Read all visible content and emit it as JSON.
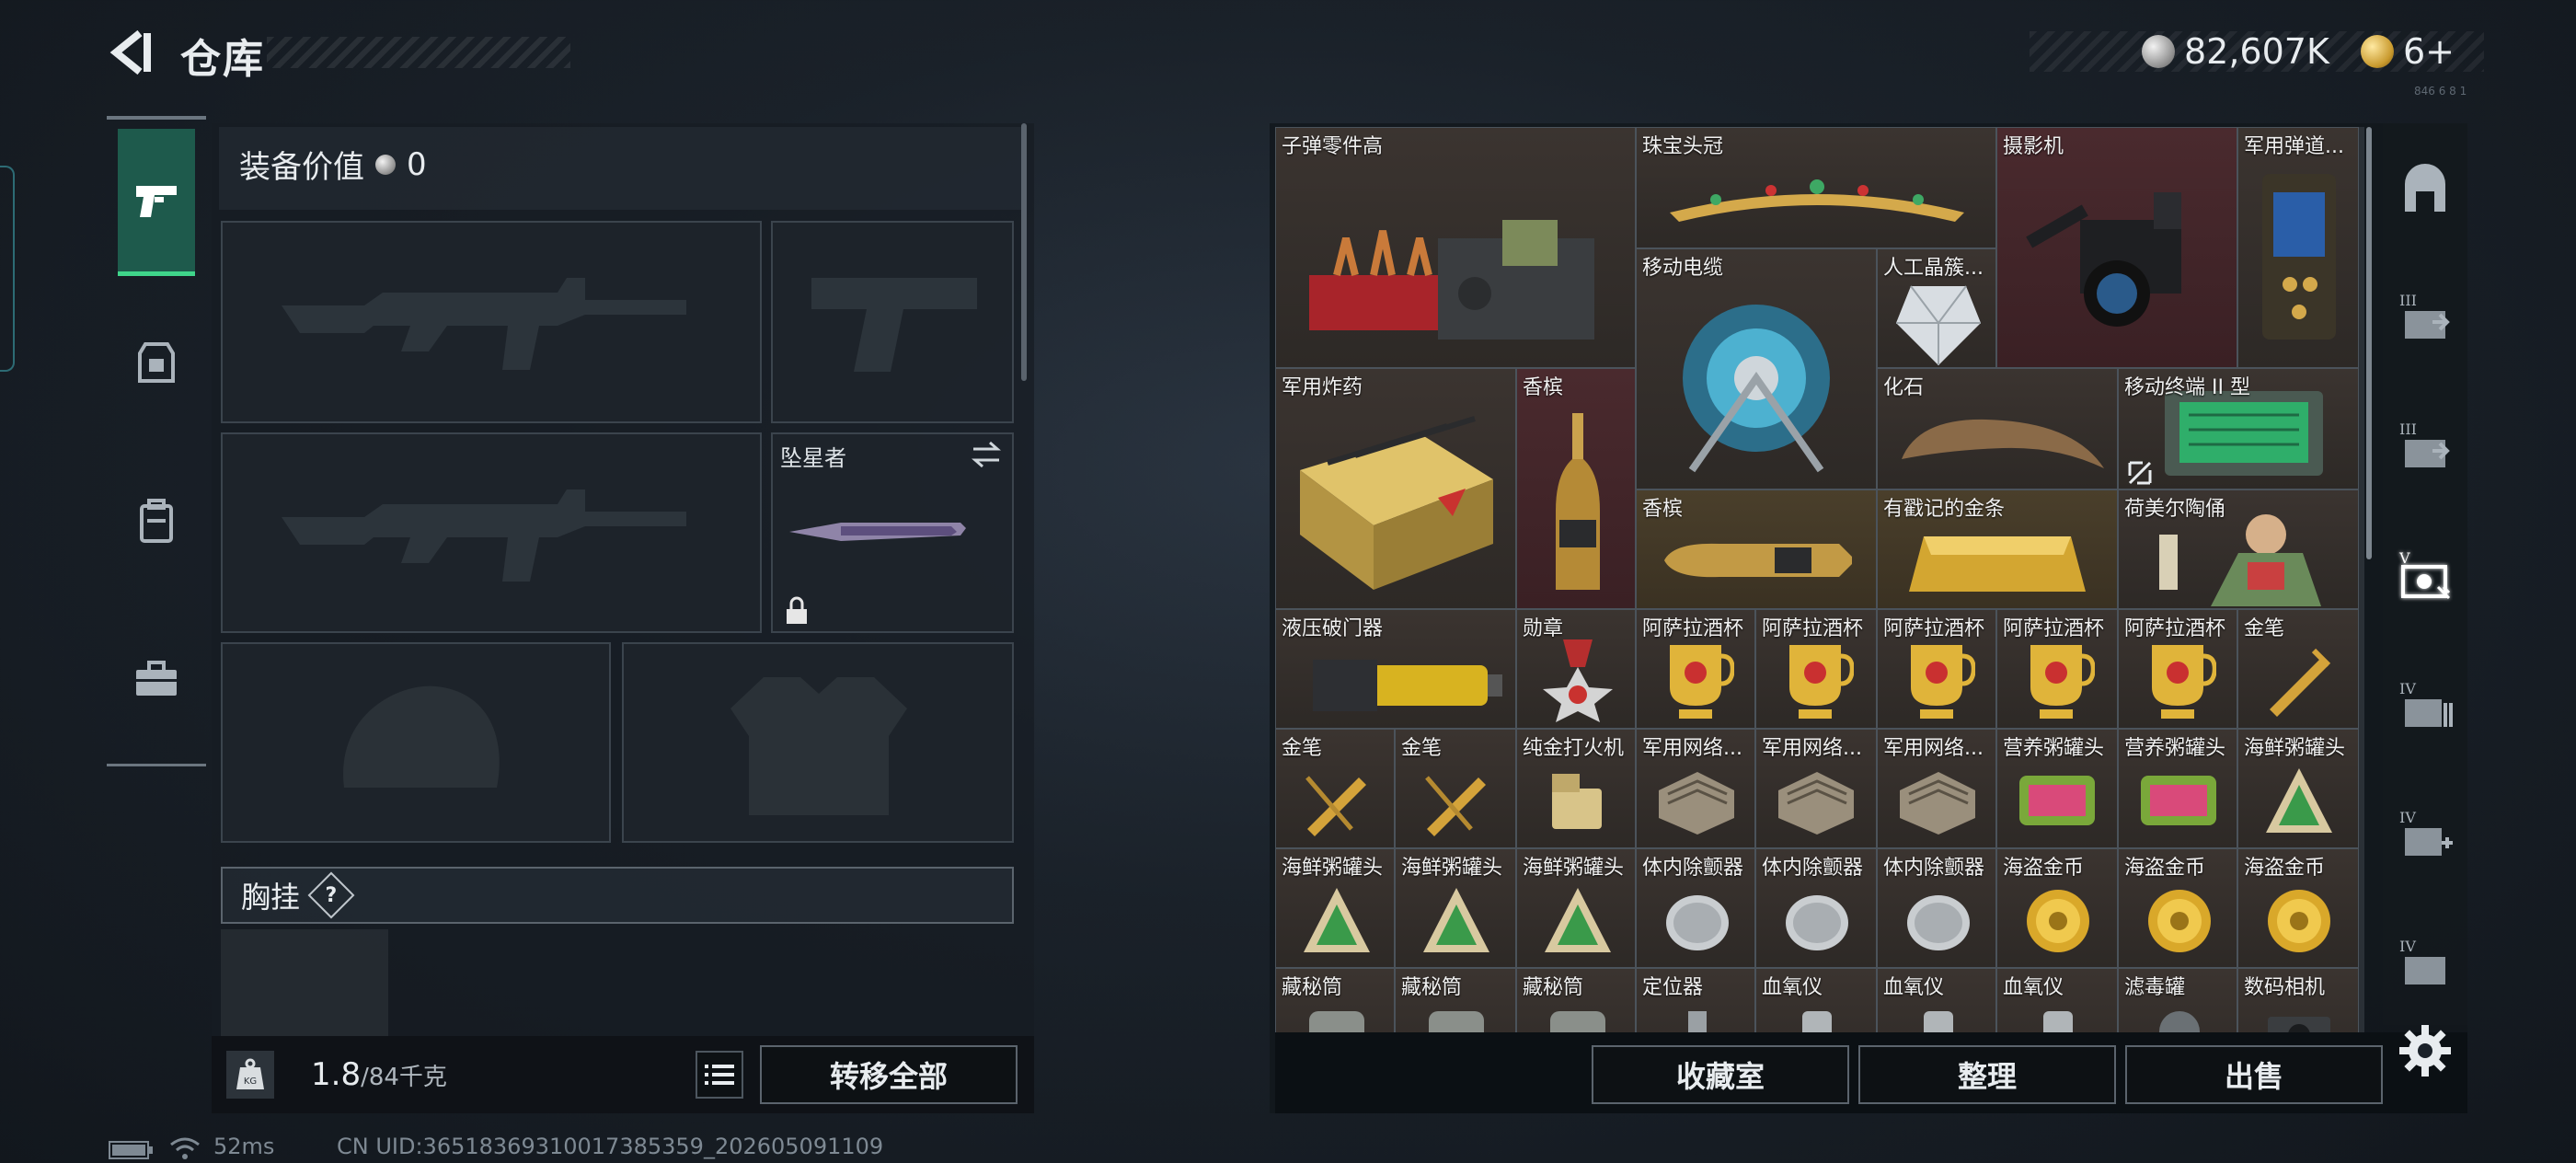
{
  "header": {
    "title": "仓库",
    "currency_silver": "82,607K",
    "currency_gold": "6+",
    "version_tiny": "846 6 8 1"
  },
  "equipment": {
    "value_label": "装备价值",
    "value_amount": "0",
    "melee_name": "坠星者",
    "section_chest": "胸挂",
    "help_symbol": "?"
  },
  "weight": {
    "current": "1.8",
    "max": "/84千克",
    "icon_text": "KG"
  },
  "buttons": {
    "transfer_all": "转移全部",
    "collection_room": "收藏室",
    "organize": "整理",
    "sell": "出售"
  },
  "inventory_items": [
    "子弹零件高",
    "珠宝头冠",
    "摄影机",
    "军用弹道...",
    "移动电缆",
    "人工晶簇...",
    "军用炸药",
    "香槟",
    "化石",
    "移动终端 II 型",
    "香槟",
    "有戳记的金条",
    "荷美尔陶俑",
    "液压破门器",
    "勋章",
    "阿萨拉酒杯",
    "阿萨拉酒杯",
    "阿萨拉酒杯",
    "阿萨拉酒杯",
    "阿萨拉酒杯",
    "金笔",
    "金笔",
    "金笔",
    "纯金打火机",
    "军用网络...",
    "军用网络...",
    "军用网络...",
    "营养粥罐头",
    "营养粥罐头",
    "海鲜粥罐头",
    "海鲜粥罐头",
    "海鲜粥罐头",
    "海鲜粥罐头",
    "体内除颤器",
    "体内除颤器",
    "体内除颤器",
    "海盗金币",
    "海盗金币",
    "海盗金币",
    "藏秘筒",
    "藏秘筒",
    "藏秘筒",
    "定位器",
    "血氧仪",
    "血氧仪",
    "血氧仪",
    "滤毒罐",
    "数码相机"
  ],
  "category_tabs": [
    "III",
    "III",
    "V",
    "IV",
    "IV",
    "IV"
  ],
  "status": {
    "ping": "52ms",
    "uid": "CN UID:3651836931001738535​9_202605091109"
  },
  "colors": {
    "accent_green": "#3fd58a",
    "tab_active_bg": "#1e5a4c",
    "cell_red": "#4a2a2e",
    "cell_brown": "#3b3430"
  }
}
